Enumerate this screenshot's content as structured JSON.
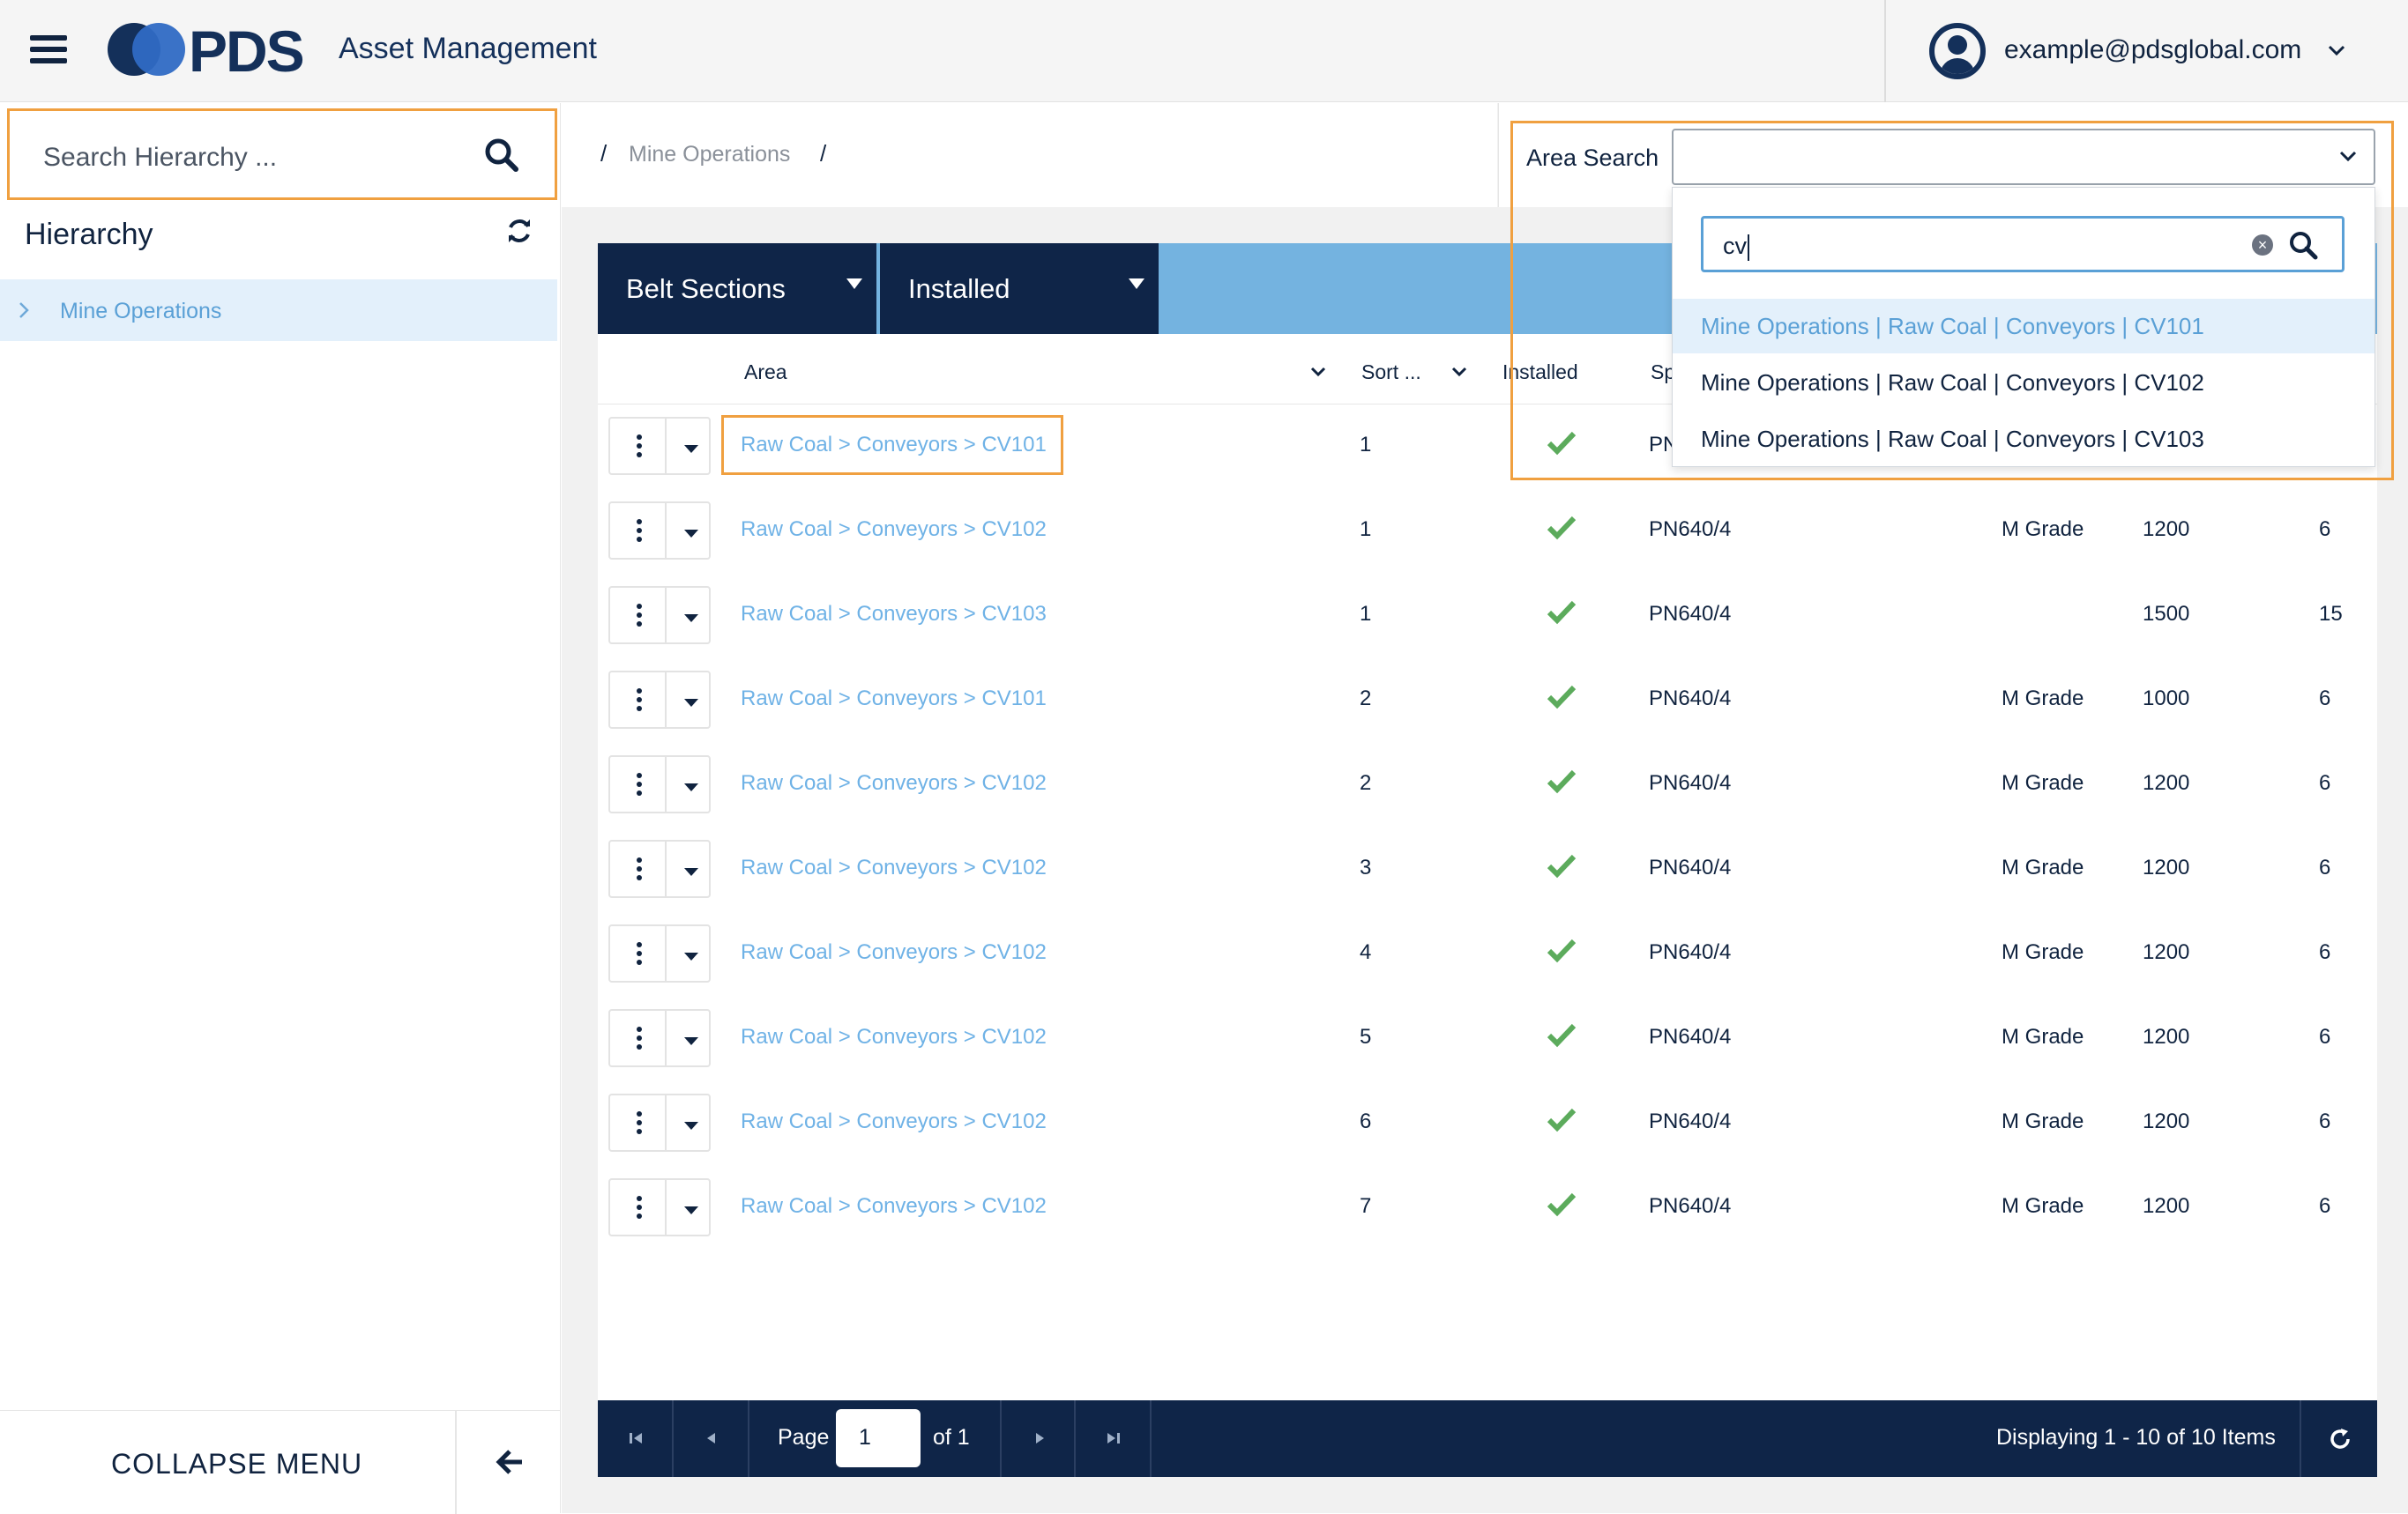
{
  "header": {
    "logo_text": "PDS",
    "app_title": "Asset Management",
    "user_email": "example@pdsglobal.com"
  },
  "sidebar": {
    "search_placeholder": "Search Hierarchy ...",
    "hierarchy_title": "Hierarchy",
    "tree_items": [
      {
        "label": "Mine Operations"
      }
    ],
    "collapse_label": "COLLAPSE MENU"
  },
  "breadcrumb": {
    "separator": "/",
    "items": [
      "Mine Operations"
    ]
  },
  "area_search": {
    "label": "Area Search",
    "selected": "",
    "search_value": "cv",
    "options": [
      {
        "label": "Mine Operations | Raw Coal | Conveyors | CV101",
        "highlighted": true
      },
      {
        "label": "Mine Operations | Raw Coal | Conveyors | CV102",
        "highlighted": false
      },
      {
        "label": "Mine Operations | Raw Coal | Conveyors | CV103",
        "highlighted": false
      }
    ]
  },
  "toolbar": {
    "view_select": "Belt Sections",
    "status_select": "Installed"
  },
  "table": {
    "columns": [
      "Area",
      "Sort ...",
      "Installed",
      "Sp"
    ],
    "rows": [
      {
        "area": "Raw Coal > Conveyors > CV101",
        "sort": "1",
        "installed": true,
        "spec": "PN",
        "grade": "",
        "width": "",
        "plies": ""
      },
      {
        "area": "Raw Coal > Conveyors > CV102",
        "sort": "1",
        "installed": true,
        "spec": "PN640/4",
        "grade": "M Grade",
        "width": "1200",
        "plies": "6"
      },
      {
        "area": "Raw Coal > Conveyors > CV103",
        "sort": "1",
        "installed": true,
        "spec": "PN640/4",
        "grade": "",
        "width": "1500",
        "plies": "15"
      },
      {
        "area": "Raw Coal > Conveyors > CV101",
        "sort": "2",
        "installed": true,
        "spec": "PN640/4",
        "grade": "M Grade",
        "width": "1000",
        "plies": "6"
      },
      {
        "area": "Raw Coal > Conveyors > CV102",
        "sort": "2",
        "installed": true,
        "spec": "PN640/4",
        "grade": "M Grade",
        "width": "1200",
        "plies": "6"
      },
      {
        "area": "Raw Coal > Conveyors > CV102",
        "sort": "3",
        "installed": true,
        "spec": "PN640/4",
        "grade": "M Grade",
        "width": "1200",
        "plies": "6"
      },
      {
        "area": "Raw Coal > Conveyors > CV102",
        "sort": "4",
        "installed": true,
        "spec": "PN640/4",
        "grade": "M Grade",
        "width": "1200",
        "plies": "6"
      },
      {
        "area": "Raw Coal > Conveyors > CV102",
        "sort": "5",
        "installed": true,
        "spec": "PN640/4",
        "grade": "M Grade",
        "width": "1200",
        "plies": "6"
      },
      {
        "area": "Raw Coal > Conveyors > CV102",
        "sort": "6",
        "installed": true,
        "spec": "PN640/4",
        "grade": "M Grade",
        "width": "1200",
        "plies": "6"
      },
      {
        "area": "Raw Coal > Conveyors > CV102",
        "sort": "7",
        "installed": true,
        "spec": "PN640/4",
        "grade": "M Grade",
        "width": "1200",
        "plies": "6"
      }
    ]
  },
  "pager": {
    "page_label": "Page",
    "page_value": "1",
    "of_label": "of 1",
    "display_text": "Displaying 1 - 10 of 10 Items"
  },
  "colors": {
    "navy": "#0f2548",
    "accent_blue": "#74b3e0",
    "link_blue": "#6fb2e6",
    "highlight_orange": "#f0a040",
    "check_green": "#5cab5c"
  }
}
